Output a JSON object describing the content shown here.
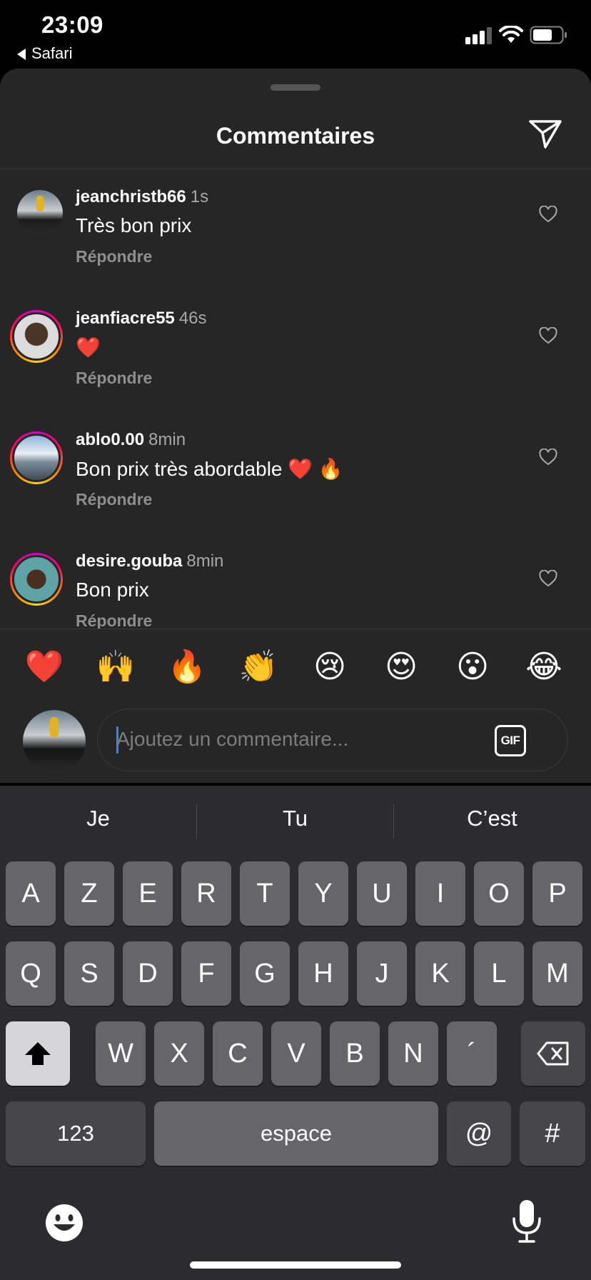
{
  "status_bar": {
    "time": "23:09",
    "back_app": "Safari"
  },
  "header": {
    "title": "Commentaires",
    "send_icon": "paper-plane-icon"
  },
  "comments": [
    {
      "username": "jeanchristb66",
      "ago": "1s",
      "text": "Très bon prix",
      "reply": "Répondre",
      "story_ring": false
    },
    {
      "username": "jeanfiacre55",
      "ago": "46s",
      "text": "❤️",
      "reply": "Répondre",
      "story_ring": true
    },
    {
      "username": "ablo0.00",
      "ago": "8min",
      "text": "Bon prix très abordable ❤️ 🔥",
      "reply": "Répondre",
      "story_ring": true
    },
    {
      "username": "desire.gouba",
      "ago": "8min",
      "text": "Bon prix",
      "reply": "Répondre",
      "story_ring": true
    }
  ],
  "quick_reactions": [
    "❤️",
    "🙌",
    "🔥",
    "👏",
    "😢",
    "😍",
    "😮",
    "😂"
  ],
  "composer": {
    "placeholder": "Ajoutez un commentaire...",
    "gif_label": "GIF"
  },
  "keyboard": {
    "suggestions": [
      "Je",
      "Tu",
      "C’est"
    ],
    "row1": [
      "A",
      "Z",
      "E",
      "R",
      "T",
      "Y",
      "U",
      "I",
      "O",
      "P"
    ],
    "row2": [
      "Q",
      "S",
      "D",
      "F",
      "G",
      "H",
      "J",
      "K",
      "L",
      "M"
    ],
    "row3": [
      "W",
      "X",
      "C",
      "V",
      "B",
      "N",
      "´"
    ],
    "numbers_key": "123",
    "space_key": "espace",
    "at_key": "@",
    "hash_key": "#"
  },
  "colors": {
    "sheet": "#262626",
    "accent_caret": "#3b82f6",
    "muted": "#8e8e8e"
  }
}
